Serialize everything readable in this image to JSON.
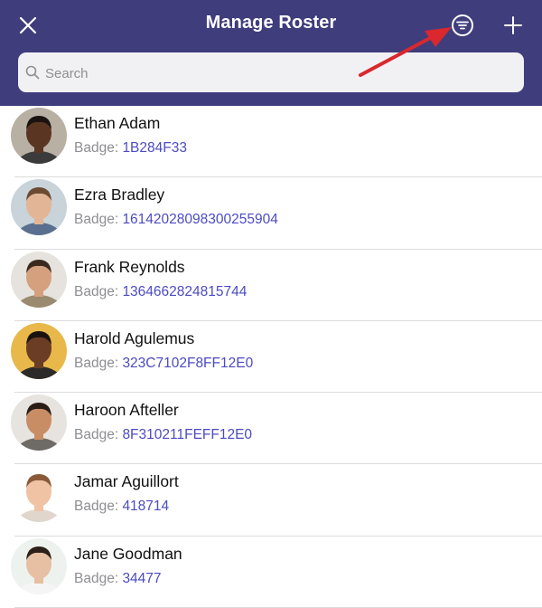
{
  "header": {
    "title": "Manage Roster",
    "close_icon": "close-icon",
    "filter_icon": "filter-icon",
    "add_icon": "plus-icon",
    "background": "#3f3d7c"
  },
  "search": {
    "placeholder": "Search",
    "value": ""
  },
  "badge_prefix": "Badge: ",
  "members": [
    {
      "name": "Ethan Adam",
      "badge": "1B284F33",
      "skin": "#5a3522",
      "hair": "#1a1310",
      "bg": "#b9b0a4",
      "shirt": "#3b3b3b"
    },
    {
      "name": "Ezra Bradley",
      "badge": "16142028098300255904",
      "skin": "#e2b596",
      "hair": "#6b4a30",
      "bg": "#c8d3da",
      "shirt": "#5a6f8f"
    },
    {
      "name": "Frank Reynolds",
      "badge": "1364662824815744",
      "skin": "#d4a07e",
      "hair": "#3a2a1e",
      "bg": "#e6e3de",
      "shirt": "#9a8a70"
    },
    {
      "name": "Harold Agulemus",
      "badge": "323C7102F8FF12E0",
      "skin": "#6b3d24",
      "hair": "#1a1210",
      "bg": "#e8b84a",
      "shirt": "#2c2a28"
    },
    {
      "name": "Haroon Afteller",
      "badge": "8F310211FEFF12E0",
      "skin": "#c98d66",
      "hair": "#2a1d16",
      "bg": "#e7e3df",
      "shirt": "#6e6a66"
    },
    {
      "name": "Jamar Aguillort",
      "badge": "418714",
      "skin": "#efc3a4",
      "hair": "#8a5a38",
      "bg": "#ffffff",
      "shirt": "#e0d6cc"
    },
    {
      "name": "Jane Goodman",
      "badge": "34477",
      "skin": "#e7bfa2",
      "hair": "#2c1f18",
      "bg": "#eef2ee",
      "shirt": "#f5f5f5"
    }
  ],
  "colors": {
    "badge_value": "#4b4bc3",
    "annotation_arrow": "#d9282e"
  }
}
